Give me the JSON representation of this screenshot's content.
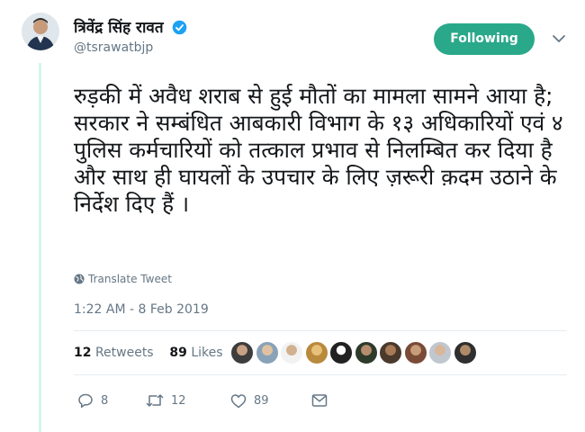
{
  "author": {
    "display_name": "त्रिवेंद्र सिंह रावत",
    "handle": "@tsrawatbjp",
    "verified": true
  },
  "follow_button": {
    "label": "Following"
  },
  "tweet": {
    "text": "रुड़की में अवैध शराब से हुई मौतों का मामला सामने आया है; सरकार ने सम्बंधित आबकारी विभाग के १३ अधिकारियों एवं ४ पुलिस कर्मचारियों को तत्काल प्रभाव से निलम्बित कर दिया है और साथ ही घायलों के उपचार के लिए ज़रूरी क़दम उठाने के निर्देश दिए हैं ।",
    "translate_label": "Translate Tweet",
    "timestamp": "1:22 AM - 8 Feb 2019"
  },
  "stats": {
    "retweets_count": "12",
    "retweets_label": "Retweets",
    "likes_count": "89",
    "likes_label": "Likes"
  },
  "actions": {
    "reply_count": "8",
    "retweet_count": "12",
    "like_count": "89"
  },
  "colors": {
    "accent": "#2aa88a",
    "thread_line": "#d4f7e9",
    "muted_text": "#657786"
  },
  "icons": [
    "verified-icon",
    "chevron-down-icon",
    "globe-icon",
    "reply-icon",
    "retweet-icon",
    "like-icon",
    "message-icon"
  ]
}
